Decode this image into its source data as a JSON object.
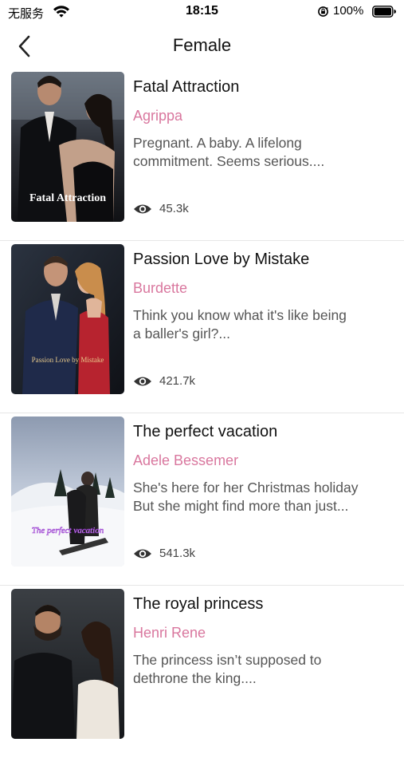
{
  "status_bar": {
    "carrier": "无服务",
    "time": "18:15",
    "battery": "100%"
  },
  "nav": {
    "title": "Female"
  },
  "books": [
    {
      "title": "Fatal Attraction",
      "author": "Agrippa",
      "description": "Pregnant. A baby. A lifelong\ncommitment. Seems  serious....",
      "views": "45.3k",
      "cover_text": "Fatal Attraction"
    },
    {
      "title": "Passion Love by Mistake",
      "author": "Burdette",
      "description": "Think you know what it's like being\na baller's girl?...",
      "views": "421.7k",
      "cover_text": "Passion Love by Mistake"
    },
    {
      "title": "The perfect vacation",
      "author": "Adele Bessemer",
      "description": "She's here for her Christmas holiday\nBut she might find more than just...",
      "views": "541.3k",
      "cover_text": "The perfect vacation"
    },
    {
      "title": "The royal princess",
      "author": "Henri Rene",
      "description": "The princess isn’t supposed to\ndethrone the king....",
      "views": null,
      "cover_text": null
    }
  ],
  "colors": {
    "author": "#d9779e",
    "divider": "#e6e6e6"
  },
  "icons": {
    "back": "chevron-left-icon",
    "views": "eye-icon",
    "wifi": "wifi-icon",
    "rotation_lock": "rotation-lock-icon",
    "battery": "battery-icon"
  }
}
